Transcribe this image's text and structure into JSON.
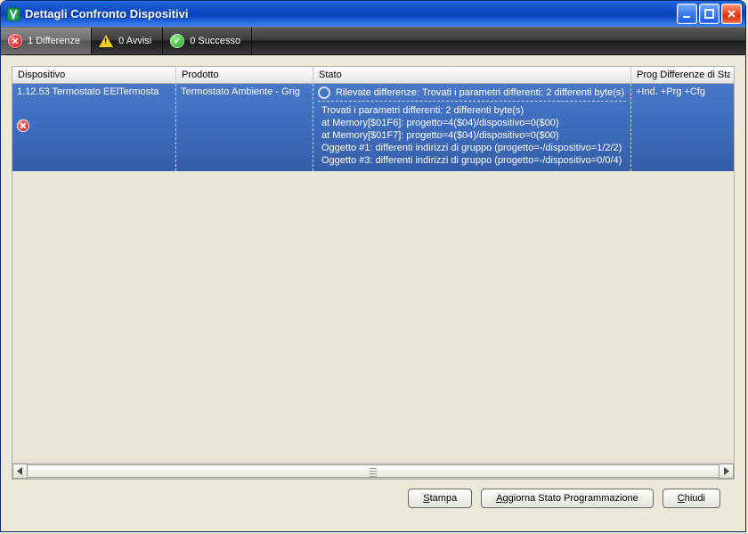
{
  "window": {
    "title": "Dettagli Confronto Dispositivi"
  },
  "tabs": {
    "differenze": {
      "count": "1",
      "label": "Differenze"
    },
    "avvisi": {
      "count": "0",
      "label": "Avvisi"
    },
    "successo": {
      "count": "0",
      "label": "Successo"
    }
  },
  "columns": {
    "dispositivo": "Dispositivo",
    "prodotto": "Prodotto",
    "stato": "Stato",
    "prog": "Prog Differenze di Stato"
  },
  "row": {
    "dispositivo": "1.12.53 Termostato EElTermosta",
    "prodotto": "Termostato Ambiente - Grig",
    "stato_head": "Rilevate differenze: Trovati i parametri differenti: 2 differenti byte(s)",
    "stato_lines": [
      "Trovati i parametri differenti: 2 differenti byte(s)",
      "at Memory[$01F6]: progetto=4($04)/dispositivo=0($00)",
      "at Memory[$01F7]: progetto=4($04)/dispositivo=0($00)",
      "Oggetto #1: differenti indirizzi di gruppo (progetto=-/dispositivo=1/2/2)",
      "Oggetto #3: differenti indirizzi di gruppo (progetto=-/dispositivo=0/0/4)"
    ],
    "prog": "+Ind. +Prg +Cfg"
  },
  "buttons": {
    "stampa": "Stampa",
    "aggiorna": "Aggiorna Stato Programmazione",
    "chiudi": "Chiudi"
  }
}
